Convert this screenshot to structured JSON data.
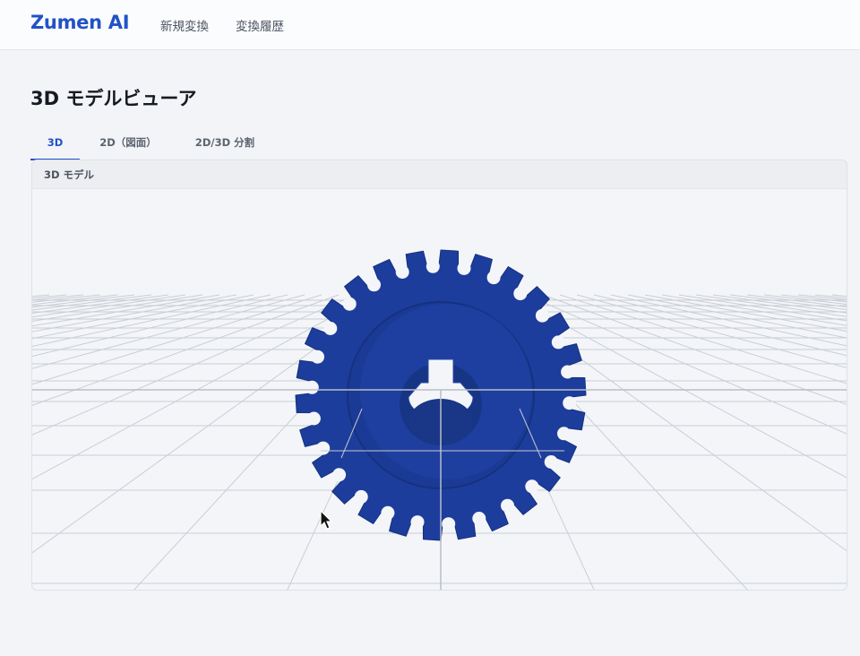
{
  "app": {
    "brand": "Zumen AI",
    "nav": [
      "新規変換",
      "変換履歴"
    ]
  },
  "page": {
    "title": "3D モデルビューア",
    "tabs": [
      "3D",
      "2D（図面）",
      "2D/3D 分割"
    ],
    "active_tab": "3D"
  },
  "viewer": {
    "panel_title": "3D モデル",
    "model": {
      "type": "spur gear with keyway",
      "tooth_count": 26,
      "color": "#1d3d9c"
    },
    "grid_color": "#c9ced6"
  }
}
